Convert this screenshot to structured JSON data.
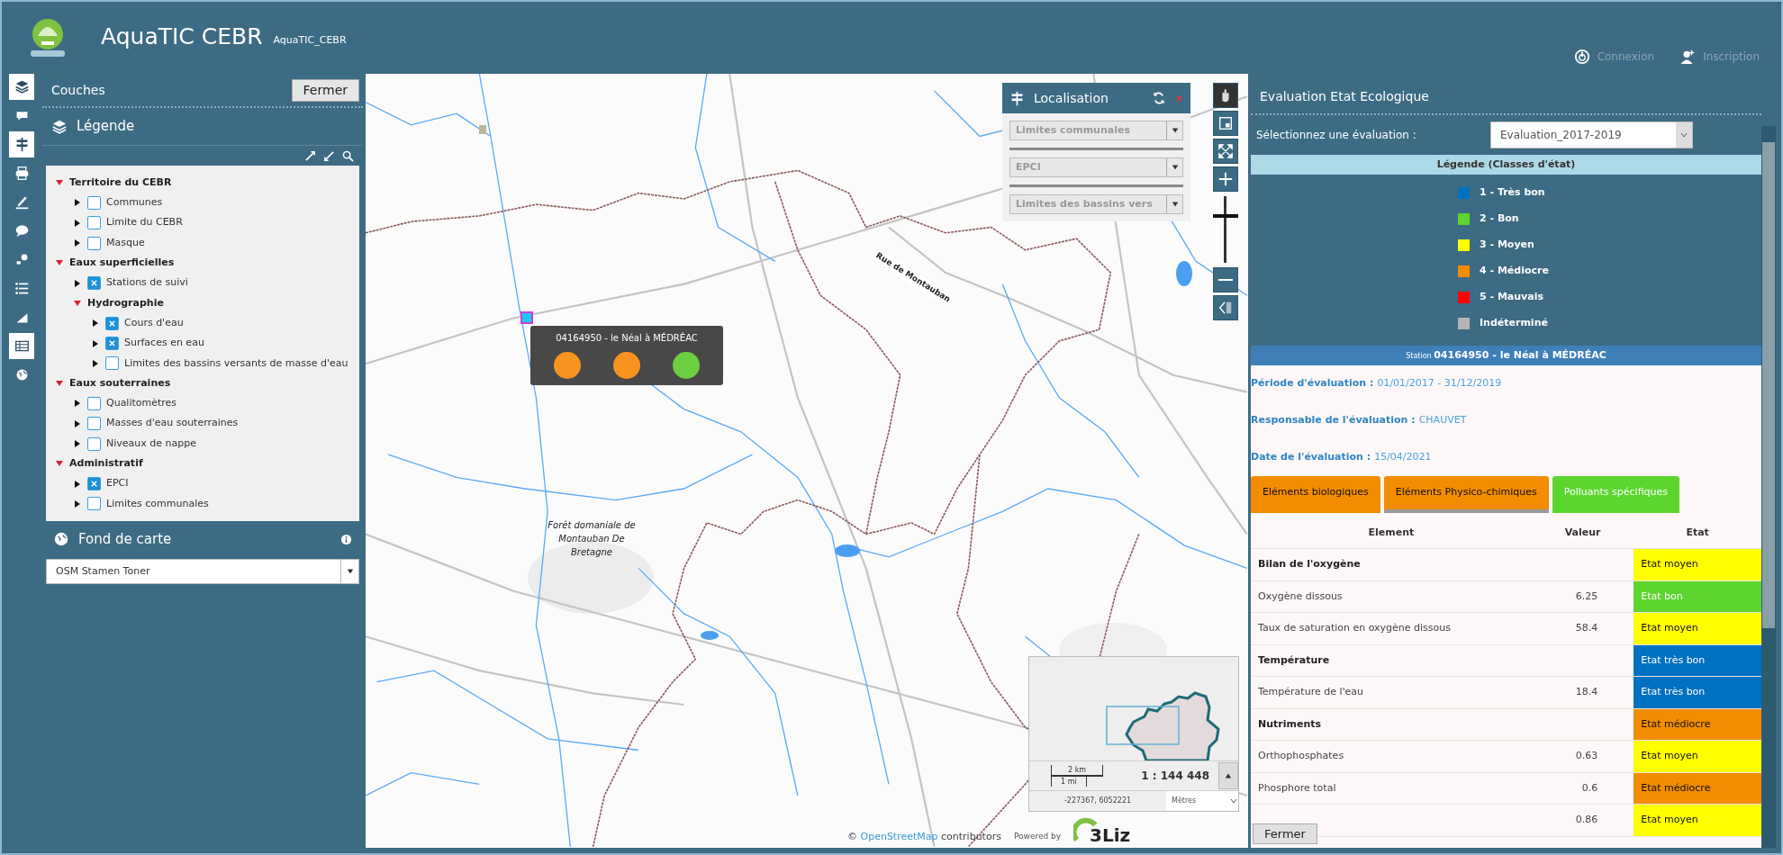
{
  "header": {
    "title": "AquaTIC CEBR",
    "subtitle": "AquaTIC_CEBR",
    "links": [
      {
        "label": "Connexion",
        "kind": "login"
      },
      {
        "label": "Inscription",
        "kind": "register"
      }
    ]
  },
  "toolbar": [
    {
      "kind": "layers",
      "selected": true
    },
    {
      "kind": "comment",
      "selected": false
    },
    {
      "kind": "signpost",
      "selected": true
    },
    {
      "kind": "print",
      "selected": false
    },
    {
      "kind": "draw",
      "selected": false
    },
    {
      "kind": "bubble",
      "selected": false
    },
    {
      "kind": "pin",
      "selected": false
    },
    {
      "kind": "list",
      "selected": false
    },
    {
      "kind": "chart",
      "selected": false
    },
    {
      "kind": "table",
      "selected": true
    },
    {
      "kind": "globe",
      "selected": false
    }
  ],
  "layers_panel": {
    "title": "Couches",
    "close": "Fermer",
    "legend_title": "Légende",
    "tree": [
      {
        "label": "Territoire du CEBR",
        "expanded": true,
        "children": [
          {
            "label": "Communes",
            "expanded": false,
            "checked": false
          },
          {
            "label": "Limite du CEBR",
            "expanded": false,
            "checked": false
          },
          {
            "label": "Masque",
            "expanded": false,
            "checked": false
          }
        ]
      },
      {
        "label": "Eaux superficielles",
        "expanded": true,
        "children": [
          {
            "label": "Stations de suivi",
            "expanded": false,
            "checked": true
          },
          {
            "label": "Hydrographie",
            "expanded": true,
            "children": [
              {
                "label": "Cours d'eau",
                "expanded": false,
                "checked": true
              },
              {
                "label": "Surfaces en eau",
                "expanded": false,
                "checked": true
              },
              {
                "label": "Limites des bassins versants de masse d'eau",
                "expanded": false,
                "checked": false
              }
            ]
          }
        ]
      },
      {
        "label": "Eaux souterraines",
        "expanded": true,
        "children": [
          {
            "label": "Qualitomètres",
            "expanded": false,
            "checked": false
          },
          {
            "label": "Masses d'eau souterraines",
            "expanded": false,
            "checked": false
          },
          {
            "label": "Niveaux de nappe",
            "expanded": false,
            "checked": false
          }
        ]
      },
      {
        "label": "Administratif",
        "expanded": true,
        "children": [
          {
            "label": "EPCI",
            "expanded": false,
            "checked": true
          },
          {
            "label": "Limites communales",
            "expanded": false,
            "checked": false
          }
        ]
      }
    ],
    "basemap": {
      "title": "Fond de carte",
      "value": "OSM Stamen Toner"
    }
  },
  "map": {
    "labels": [
      {
        "text": "Forêt domaniale de Montauban De Bretagne",
        "kind": "forest"
      },
      {
        "text": "Rue de Montauban",
        "kind": "road"
      }
    ],
    "localisation": {
      "title": "Localisation",
      "selects": [
        "Limites communales",
        "EPCI",
        "Limites des bassins vers"
      ]
    },
    "zoom": {
      "level": 0.7
    },
    "popup": {
      "title": "04164950 - le Néal à MÉDRÉAC",
      "dots": [
        {
          "color": "#f7931e"
        },
        {
          "color": "#f7931e"
        },
        {
          "color": "#6ccf3f"
        }
      ]
    },
    "overview": {
      "scale_top": "2 km",
      "scale_bottom": "1 mi",
      "scale": "1 : 144 448",
      "coordinates": "-227367, 6052221",
      "units": "Mètres"
    },
    "attribution": {
      "prefix": "©",
      "link": "OpenStreetMap",
      "suffix": "contributors",
      "powered": "Powered by",
      "brand": "3Liz"
    }
  },
  "evaluation": {
    "title": "Evaluation Etat Ecologique",
    "select_label": "Sélectionnez une évaluation :",
    "select_value": "Evaluation_2017-2019",
    "legend": {
      "title": "Légende (Classes d'état)",
      "items": [
        {
          "label": "1 - Très bon",
          "color": "#0070c0"
        },
        {
          "label": "2 - Bon",
          "color": "#5dd52f"
        },
        {
          "label": "3 - Moyen",
          "color": "#ffff00"
        },
        {
          "label": "4 - Médiocre",
          "color": "#f28c00"
        },
        {
          "label": "5 - Mauvais",
          "color": "#ff0000"
        },
        {
          "label": "Indéterminé",
          "color": "#b4b4b4"
        }
      ]
    },
    "station_prefix": "Station",
    "station": "04164950 - le Néal à MÉDRÉAC",
    "info": [
      {
        "label": "Période d'évaluation :",
        "value": "01/01/2017 - 31/12/2019"
      },
      {
        "label": "Responsable de l'évaluation :",
        "value": "CHAUVET"
      },
      {
        "label": "Date de l'évaluation :",
        "value": "15/04/2021"
      }
    ],
    "tabs": [
      {
        "label": "Eléments biologiques",
        "color": "#f28c00",
        "selected": false
      },
      {
        "label": "Eléments Physico-chimiques",
        "color": "#f28c00",
        "selected": true
      },
      {
        "label": "Polluants spécifiques",
        "color": "#5dd52f",
        "selected": false
      }
    ],
    "columns": [
      "Element",
      "Valeur",
      "Etat"
    ],
    "rows": [
      {
        "kind": "group",
        "element": "Bilan de l'oxygène",
        "state": "Etat moyen",
        "color": "#ffff00"
      },
      {
        "kind": "param",
        "element": "Oxygène dissous",
        "value": "6.25",
        "state": "Etat bon",
        "color": "#5dd52f"
      },
      {
        "kind": "param",
        "element": "Taux de saturation en oxygène dissous",
        "value": "58.4",
        "state": "Etat moyen",
        "color": "#ffff00"
      },
      {
        "kind": "group",
        "element": "Température",
        "state": "Etat très bon",
        "color": "#0070c0"
      },
      {
        "kind": "param",
        "element": "Température de l'eau",
        "value": "18.4",
        "state": "Etat très bon",
        "color": "#0070c0"
      },
      {
        "kind": "group",
        "element": "Nutriments",
        "state": "Etat médiocre",
        "color": "#f28c00"
      },
      {
        "kind": "param",
        "element": "Orthophosphates",
        "value": "0.63",
        "state": "Etat moyen",
        "color": "#ffff00"
      },
      {
        "kind": "param",
        "element": "Phosphore total",
        "value": "0.6",
        "state": "Etat médiocre",
        "color": "#f28c00"
      },
      {
        "kind": "param",
        "value": "0.86",
        "state": "Etat moyen",
        "color": "#ffff00"
      }
    ],
    "close": "Fermer"
  }
}
